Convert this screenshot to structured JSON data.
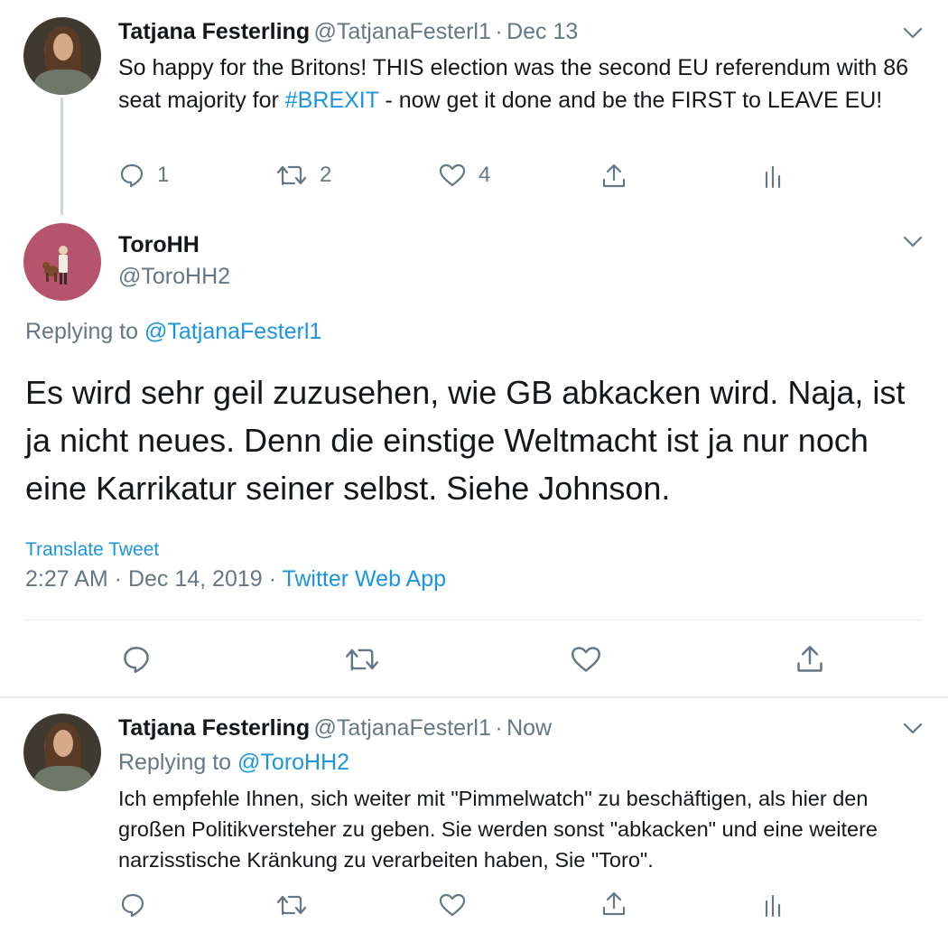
{
  "tweet1": {
    "name": "Tatjana Festerling",
    "handle": "@TatjanaFesterl1",
    "separator": "·",
    "time": "Dec 13",
    "text_part1": "So happy for the Britons! THIS election was the second EU referendum with 86 seat majority for ",
    "hashtag": "#BREXIT",
    "text_part2": " - now get it done and be the FIRST to LEAVE EU!",
    "reply_count": "1",
    "retweet_count": "2",
    "like_count": "4"
  },
  "tweet2": {
    "name": "ToroHH",
    "handle": "@ToroHH2",
    "replying_prefix": "Replying to ",
    "replying_to": "@TatjanaFesterl1",
    "text": "Es wird sehr geil zuzusehen, wie GB abkacken wird. Naja, ist ja nicht neues. Denn die einstige Weltmacht ist ja nur noch eine Karrikatur seiner selbst. Siehe Johnson.",
    "translate": "Translate Tweet",
    "timestamp": "2:27 AM · Dec 14, 2019",
    "separator": "·",
    "source": "Twitter Web App"
  },
  "tweet3": {
    "name": "Tatjana Festerling",
    "handle": "@TatjanaFesterl1",
    "separator": "·",
    "time": "Now",
    "replying_prefix": "Replying to ",
    "replying_to": "@ToroHH2",
    "text": "Ich empfehle Ihnen, sich weiter mit \"Pimmelwatch\" zu beschäftigen, als hier den großen Politikversteher zu geben. Sie werden sonst \"abkacken\" und eine weitere narzisstische Kränkung zu verarbeiten haben, Sie \"Toro\"."
  },
  "colors": {
    "link": "#1b95e0",
    "secondary": "#657786",
    "divider": "#e6ecf0",
    "thread_line": "#ccd6dd",
    "toro_avatar_bg": "#b6536d"
  },
  "icons": [
    "reply-icon",
    "retweet-icon",
    "like-icon",
    "share-icon",
    "analytics-icon",
    "chevron-down-icon"
  ]
}
